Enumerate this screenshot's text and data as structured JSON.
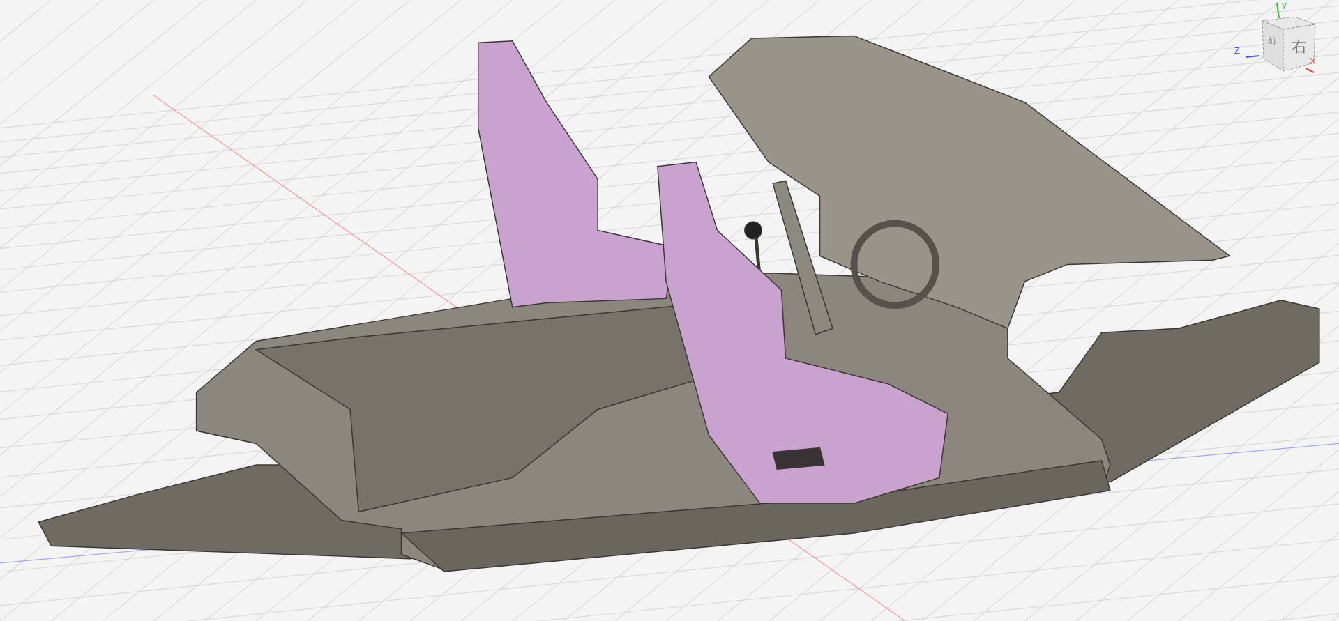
{
  "viewport": {
    "view_cube": {
      "faces": [
        {
          "label": "前"
        },
        {
          "label": "右"
        }
      ],
      "axes": [
        {
          "label": "Y",
          "color": "#2fc42f"
        },
        {
          "label": "Z",
          "color": "#3b5bff"
        },
        {
          "label": "X",
          "color": "#ff3b3b"
        }
      ]
    }
  }
}
